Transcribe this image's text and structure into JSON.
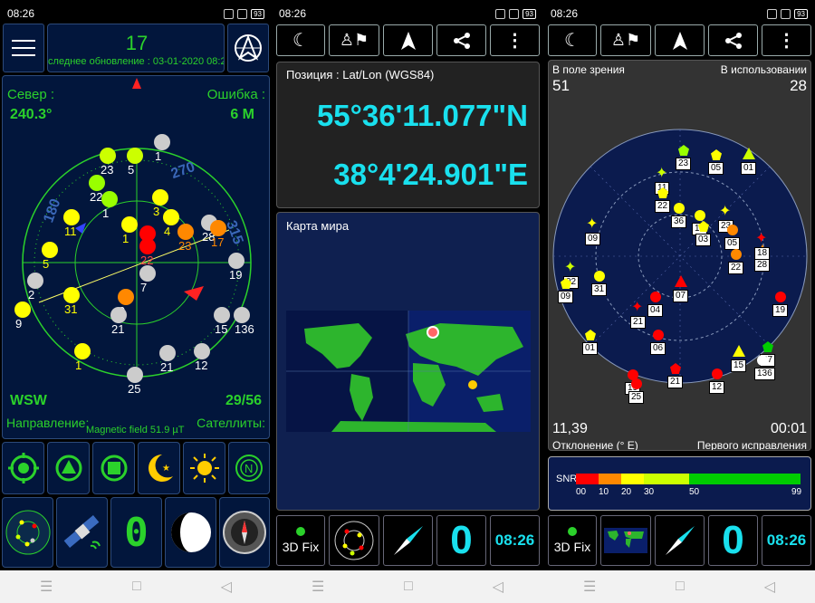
{
  "status": {
    "time": "08:26",
    "battery": "93"
  },
  "s1": {
    "sat_count": "17",
    "last_update": "Последнее обновление : 03-01-2020 08:25",
    "north_label": "Север :",
    "north_value": "240.3°",
    "error_label": "Ошибка :",
    "error_value": "6 М",
    "heading_dir": "WSW",
    "sats_ratio": "29/56",
    "direction_label": "Направление:",
    "magnetic": "Magnetic field 51.9 µT",
    "sats_label": "Сателлиты:",
    "compass_ticks": [
      "180",
      "270",
      "315"
    ],
    "seven_seg": "0",
    "sats": [
      {
        "id": "1",
        "c": "#cccccc",
        "tc": "#ffffff"
      },
      {
        "id": "23",
        "c": "#ccff00",
        "tc": "#ffffff"
      },
      {
        "id": "5",
        "c": "#ccff00",
        "tc": "#ffffff"
      },
      {
        "id": "22",
        "c": "#99ff00",
        "tc": "#ffffff"
      },
      {
        "id": "1",
        "c": "#99ff00",
        "tc": "#ffffff"
      },
      {
        "id": "11",
        "c": "#ffff00",
        "tc": "#ffff00"
      },
      {
        "id": "3",
        "c": "#ffff00",
        "tc": "#ffff00"
      },
      {
        "id": "4",
        "c": "#ffff00",
        "tc": "#ffff00"
      },
      {
        "id": "1",
        "c": "#ffff00",
        "tc": "#ffff00"
      },
      {
        "id": "36",
        "c": "#ff0000",
        "tc": "#ffffff"
      },
      {
        "id": "22",
        "c": "#ff0000",
        "tc": "#ff4444"
      },
      {
        "id": "23",
        "c": "#ff8800",
        "tc": "#ff8800"
      },
      {
        "id": "28",
        "c": "#cccccc",
        "tc": "#ffffff"
      },
      {
        "id": "17",
        "c": "#ff8800",
        "tc": "#ff8800"
      },
      {
        "id": "5",
        "c": "#ffff00",
        "tc": "#ffff00"
      },
      {
        "id": "19",
        "c": "#cccccc",
        "tc": "#ffffff"
      },
      {
        "id": "7",
        "c": "#cccccc",
        "tc": "#ffffff"
      },
      {
        "id": "2",
        "c": "#cccccc",
        "tc": "#ffffff"
      },
      {
        "id": "31",
        "c": "#ffff00",
        "tc": "#ffff00"
      },
      {
        "id": "9",
        "c": "#ffff00",
        "tc": "#ffffff"
      },
      {
        "id": "9",
        "c": "#ff8800",
        "tc": "#ffffff"
      },
      {
        "id": "21",
        "c": "#cccccc",
        "tc": "#ffffff"
      },
      {
        "id": "15",
        "c": "#cccccc",
        "tc": "#ffffff"
      },
      {
        "id": "136",
        "c": "#cccccc",
        "tc": "#ffffff"
      },
      {
        "id": "1",
        "c": "#ffff00",
        "tc": "#ffff00"
      },
      {
        "id": "21",
        "c": "#cccccc",
        "tc": "#ffffff"
      },
      {
        "id": "12",
        "c": "#cccccc",
        "tc": "#ffffff"
      },
      {
        "id": "25",
        "c": "#cccccc",
        "tc": "#ffffff"
      }
    ]
  },
  "s2": {
    "position_label": "Позиция : Lat/Lon (WGS84)",
    "lat": "55°36'11.077\"N",
    "lon": "38°4'24.901\"E",
    "map_label": "Карта мира",
    "fix_label": "3D Fix",
    "big_zero": "0",
    "clock": "08:26"
  },
  "s3": {
    "in_view_label": "В поле зрения",
    "in_view": "51",
    "in_use_label": "В использовании",
    "in_use": "28",
    "decl_value": "11,39",
    "decl_label": "Отклонение (° E)",
    "ttff_value": "00:01",
    "ttff_label": "Первого исправления",
    "snr_label": "SNR",
    "snr_ticks": [
      "00",
      "10",
      "20",
      "30",
      "50",
      "99"
    ],
    "snr_colors": [
      "#ff0000",
      "#ff8800",
      "#ffff00",
      "#ccff00",
      "#00cc00"
    ],
    "sky_labels": [
      "23",
      "05",
      "01",
      "11",
      "22",
      "09",
      "36",
      "14",
      "03",
      "23",
      "05",
      "22",
      "28",
      "18",
      "02",
      "31",
      "09",
      "07",
      "19",
      "21",
      "04",
      "06",
      "15",
      "01",
      "21",
      "12",
      "27",
      "136",
      "19",
      "25"
    ],
    "fix_label": "3D Fix",
    "big_zero": "0",
    "clock": "08:26"
  }
}
